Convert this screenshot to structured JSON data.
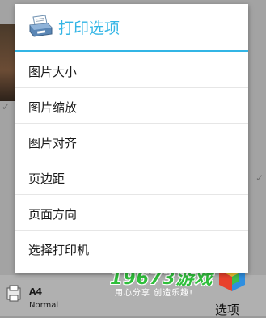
{
  "dialog": {
    "title": "打印选项",
    "icon": "printer-icon",
    "accent_color": "#33b5e5",
    "items": [
      {
        "label": "图片大小"
      },
      {
        "label": "图片缩放"
      },
      {
        "label": "图片对齐"
      },
      {
        "label": "页边距"
      },
      {
        "label": "页面方向"
      },
      {
        "label": "选择打印机"
      }
    ]
  },
  "bottom_bar": {
    "paper_size": "A4",
    "paper_quality": "Normal",
    "options_label": "选项"
  },
  "watermark": {
    "brand": "19673游戏",
    "slogan": "用心分享 创造乐趣!"
  }
}
